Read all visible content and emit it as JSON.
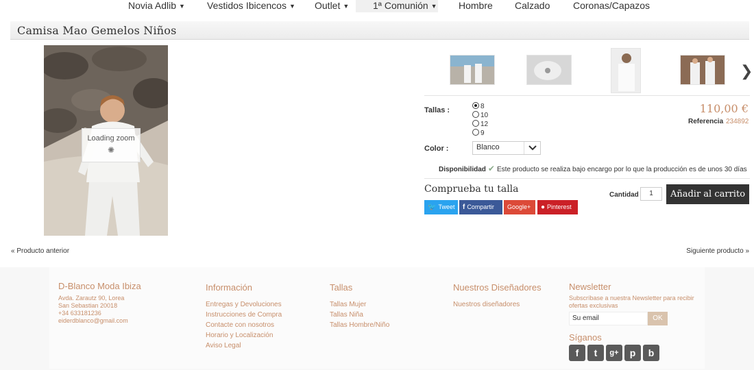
{
  "nav": {
    "items": [
      {
        "label": "Novia Adlib",
        "dropdown": true
      },
      {
        "label": "Vestidos Ibicencos",
        "dropdown": true
      },
      {
        "label": "Outlet",
        "dropdown": true
      },
      {
        "label": "1ª Comunión",
        "dropdown": true
      },
      {
        "label": "Hombre",
        "dropdown": false
      },
      {
        "label": "Calzado",
        "dropdown": false
      },
      {
        "label": "Coronas/Capazos",
        "dropdown": false
      }
    ]
  },
  "product": {
    "title": "Camisa Mao Gemelos Niños",
    "loading_zoom": "Loading zoom",
    "thumb_next_icon": "chevron-right-icon",
    "sizes_label": "Tallas :",
    "sizes": [
      {
        "label": "8",
        "selected": true
      },
      {
        "label": "10",
        "selected": false
      },
      {
        "label": "12",
        "selected": false
      },
      {
        "label": "9",
        "selected": false
      }
    ],
    "color_label": "Color :",
    "color_value": "Blanco",
    "price": "110,00 €",
    "reference_label": "Referencia",
    "reference_value": "234892",
    "availability_label": "Disponibilidad",
    "availability_text": "Este producto se realiza bajo encargo por lo que la producción es de unos 30 días",
    "check_size": "Comprueba tu talla",
    "share": {
      "tweet": "Tweet",
      "facebook": "Compartir",
      "google": "Google+",
      "pinterest": "Pinterest"
    },
    "quantity_label": "Cantidad",
    "quantity_value": "1",
    "add_to_cart": "Añadir al carrito"
  },
  "pager": {
    "prev": "« Producto anterior",
    "next": "Siguiente producto »"
  },
  "footer": {
    "brand": {
      "title": "D-Blanco Moda Ibiza",
      "address1": "Avda. Zarautz 90, Lorea",
      "address2": "San Sebastian 20018",
      "phone": "+34 633181236",
      "email": "eiderdblanco@gmail.com"
    },
    "info": {
      "title": "Información",
      "links": [
        "Entregas y Devoluciones",
        "Instrucciones de Compra",
        "Contacte con nosotros",
        "Horario y Localización",
        "Aviso Legal"
      ]
    },
    "sizes": {
      "title": "Tallas",
      "links": [
        "Tallas Mujer",
        "Tallas Niña",
        "Tallas Hombre/Niño"
      ]
    },
    "designers": {
      "title": "Nuestros Diseñadores",
      "links": [
        "Nuestros diseñadores"
      ]
    },
    "newsletter": {
      "title": "Newsletter",
      "text1": "Subscríbase a nuestra Newsletter para recibir",
      "text2": "ofertas exclusivas",
      "input_value": "Su email",
      "button": "OK"
    },
    "follow": {
      "title": "Síganos",
      "icons": [
        "facebook-icon",
        "twitter-icon",
        "google-plus-icon",
        "pinterest-icon",
        "blogger-icon"
      ]
    }
  },
  "colors": {
    "accent": "#c78e6a",
    "dark_button": "#333333",
    "twitter": "#2aa3ef",
    "facebook": "#3b5998",
    "google": "#dc4a38",
    "pinterest": "#cb2027"
  }
}
